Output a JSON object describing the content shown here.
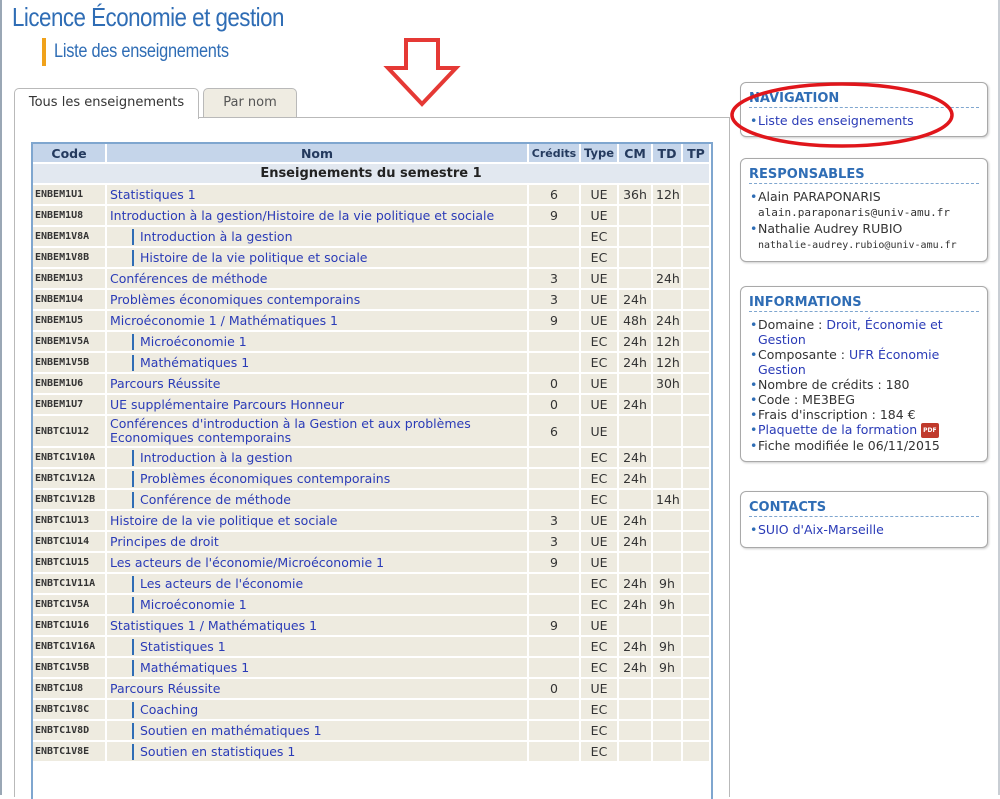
{
  "header": {
    "title": "Licence Économie et gestion",
    "subtitle": "Liste des enseignements"
  },
  "tabs": [
    {
      "label": "Tous les enseignements",
      "active": true
    },
    {
      "label": "Par nom",
      "active": false
    }
  ],
  "table": {
    "columns": [
      "Code",
      "Nom",
      "Crédits",
      "Type",
      "CM",
      "TD",
      "TP"
    ],
    "section": "Enseignements du semestre 1",
    "rows": [
      {
        "code": "ENBEM1U1",
        "name": "Statistiques 1",
        "credits": "6",
        "type": "UE",
        "cm": "36h",
        "td": "12h",
        "tp": "",
        "sub": false
      },
      {
        "code": "ENBEM1U8",
        "name": "Introduction à la gestion/Histoire de la vie politique et sociale",
        "credits": "9",
        "type": "UE",
        "cm": "",
        "td": "",
        "tp": "",
        "sub": false
      },
      {
        "code": "ENBEM1V8A",
        "name": "Introduction à la gestion",
        "credits": "",
        "type": "EC",
        "cm": "",
        "td": "",
        "tp": "",
        "sub": true
      },
      {
        "code": "ENBEM1V8B",
        "name": "Histoire de la vie politique et sociale",
        "credits": "",
        "type": "EC",
        "cm": "",
        "td": "",
        "tp": "",
        "sub": true
      },
      {
        "code": "ENBEM1U3",
        "name": "Conférences de méthode",
        "credits": "3",
        "type": "UE",
        "cm": "",
        "td": "24h",
        "tp": "",
        "sub": false
      },
      {
        "code": "ENBEM1U4",
        "name": "Problèmes économiques contemporains",
        "credits": "3",
        "type": "UE",
        "cm": "24h",
        "td": "",
        "tp": "",
        "sub": false
      },
      {
        "code": "ENBEM1U5",
        "name": "Microéconomie 1 / Mathématiques 1",
        "credits": "9",
        "type": "UE",
        "cm": "48h",
        "td": "24h",
        "tp": "",
        "sub": false
      },
      {
        "code": "ENBEM1V5A",
        "name": "Microéconomie 1",
        "credits": "",
        "type": "EC",
        "cm": "24h",
        "td": "12h",
        "tp": "",
        "sub": true
      },
      {
        "code": "ENBEM1V5B",
        "name": "Mathématiques 1",
        "credits": "",
        "type": "EC",
        "cm": "24h",
        "td": "12h",
        "tp": "",
        "sub": true
      },
      {
        "code": "ENBEM1U6",
        "name": "Parcours Réussite",
        "credits": "0",
        "type": "UE",
        "cm": "",
        "td": "30h",
        "tp": "",
        "sub": false
      },
      {
        "code": "ENBEM1U7",
        "name": "UE supplémentaire Parcours Honneur",
        "credits": "0",
        "type": "UE",
        "cm": "24h",
        "td": "",
        "tp": "",
        "sub": false
      },
      {
        "code": "ENBTC1U12",
        "name": "Conférences d'introduction à la Gestion et aux problèmes Economiques contemporains",
        "credits": "6",
        "type": "UE",
        "cm": "",
        "td": "",
        "tp": "",
        "sub": false,
        "wrap": true
      },
      {
        "code": "ENBTC1V10A",
        "name": "Introduction à la gestion",
        "credits": "",
        "type": "EC",
        "cm": "24h",
        "td": "",
        "tp": "",
        "sub": true
      },
      {
        "code": "ENBTC1V12A",
        "name": "Problèmes économiques contemporains",
        "credits": "",
        "type": "EC",
        "cm": "24h",
        "td": "",
        "tp": "",
        "sub": true
      },
      {
        "code": "ENBTC1V12B",
        "name": "Conférence de méthode",
        "credits": "",
        "type": "EC",
        "cm": "",
        "td": "14h",
        "tp": "",
        "sub": true
      },
      {
        "code": "ENBTC1U13",
        "name": "Histoire de la vie politique et sociale",
        "credits": "3",
        "type": "UE",
        "cm": "24h",
        "td": "",
        "tp": "",
        "sub": false
      },
      {
        "code": "ENBTC1U14",
        "name": "Principes de droit",
        "credits": "3",
        "type": "UE",
        "cm": "24h",
        "td": "",
        "tp": "",
        "sub": false
      },
      {
        "code": "ENBTC1U15",
        "name": "Les acteurs de l'économie/Microéconomie 1",
        "credits": "9",
        "type": "UE",
        "cm": "",
        "td": "",
        "tp": "",
        "sub": false
      },
      {
        "code": "ENBTC1V11A",
        "name": "Les acteurs de l'économie",
        "credits": "",
        "type": "EC",
        "cm": "24h",
        "td": "9h",
        "tp": "",
        "sub": true
      },
      {
        "code": "ENBTC1V5A",
        "name": "Microéconomie 1",
        "credits": "",
        "type": "EC",
        "cm": "24h",
        "td": "9h",
        "tp": "",
        "sub": true
      },
      {
        "code": "ENBTC1U16",
        "name": "Statistiques 1 / Mathématiques 1",
        "credits": "9",
        "type": "UE",
        "cm": "",
        "td": "",
        "tp": "",
        "sub": false
      },
      {
        "code": "ENBTC1V16A",
        "name": "Statistiques 1",
        "credits": "",
        "type": "EC",
        "cm": "24h",
        "td": "9h",
        "tp": "",
        "sub": true
      },
      {
        "code": "ENBTC1V5B",
        "name": "Mathématiques 1",
        "credits": "",
        "type": "EC",
        "cm": "24h",
        "td": "9h",
        "tp": "",
        "sub": true
      },
      {
        "code": "ENBTC1U8",
        "name": "Parcours Réussite",
        "credits": "0",
        "type": "UE",
        "cm": "",
        "td": "",
        "tp": "",
        "sub": false
      },
      {
        "code": "ENBTC1V8C",
        "name": "Coaching",
        "credits": "",
        "type": "EC",
        "cm": "",
        "td": "",
        "tp": "",
        "sub": true
      },
      {
        "code": "ENBTC1V8D",
        "name": "Soutien en mathématiques 1",
        "credits": "",
        "type": "EC",
        "cm": "",
        "td": "",
        "tp": "",
        "sub": true
      },
      {
        "code": "ENBTC1V8E",
        "name": "Soutien en statistiques 1",
        "credits": "",
        "type": "EC",
        "cm": "",
        "td": "",
        "tp": "",
        "sub": true
      }
    ]
  },
  "sidebar": {
    "navigation": {
      "title": "NAVIGATION",
      "link": "Liste des enseignements"
    },
    "responsables": {
      "title": "RESPONSABLES",
      "people": [
        {
          "name": "Alain PARAPONARIS",
          "email": "alain.paraponaris@univ-amu.fr"
        },
        {
          "name": "Nathalie Audrey RUBIO",
          "email": "nathalie-audrey.rubio@univ-amu.fr"
        }
      ]
    },
    "informations": {
      "title": "INFORMATIONS",
      "domaine_label": "Domaine : ",
      "domaine_value": "Droit, Économie et Gestion",
      "composante_label": "Composante : ",
      "composante_value": "UFR Économie Gestion",
      "credits": "Nombre de crédits : 180",
      "code": "Code : ME3BEG",
      "frais": "Frais d'inscription : 184 €",
      "plaquette": "Plaquette de la formation",
      "pdf_badge": "PDF",
      "fiche": "Fiche modifiée le 06/11/2015"
    },
    "contacts": {
      "title": "CONTACTS",
      "link": "SUIO d'Aix-Marseille"
    }
  },
  "annotation_colors": {
    "arrow": "#e53935",
    "circle": "#e0161b"
  }
}
